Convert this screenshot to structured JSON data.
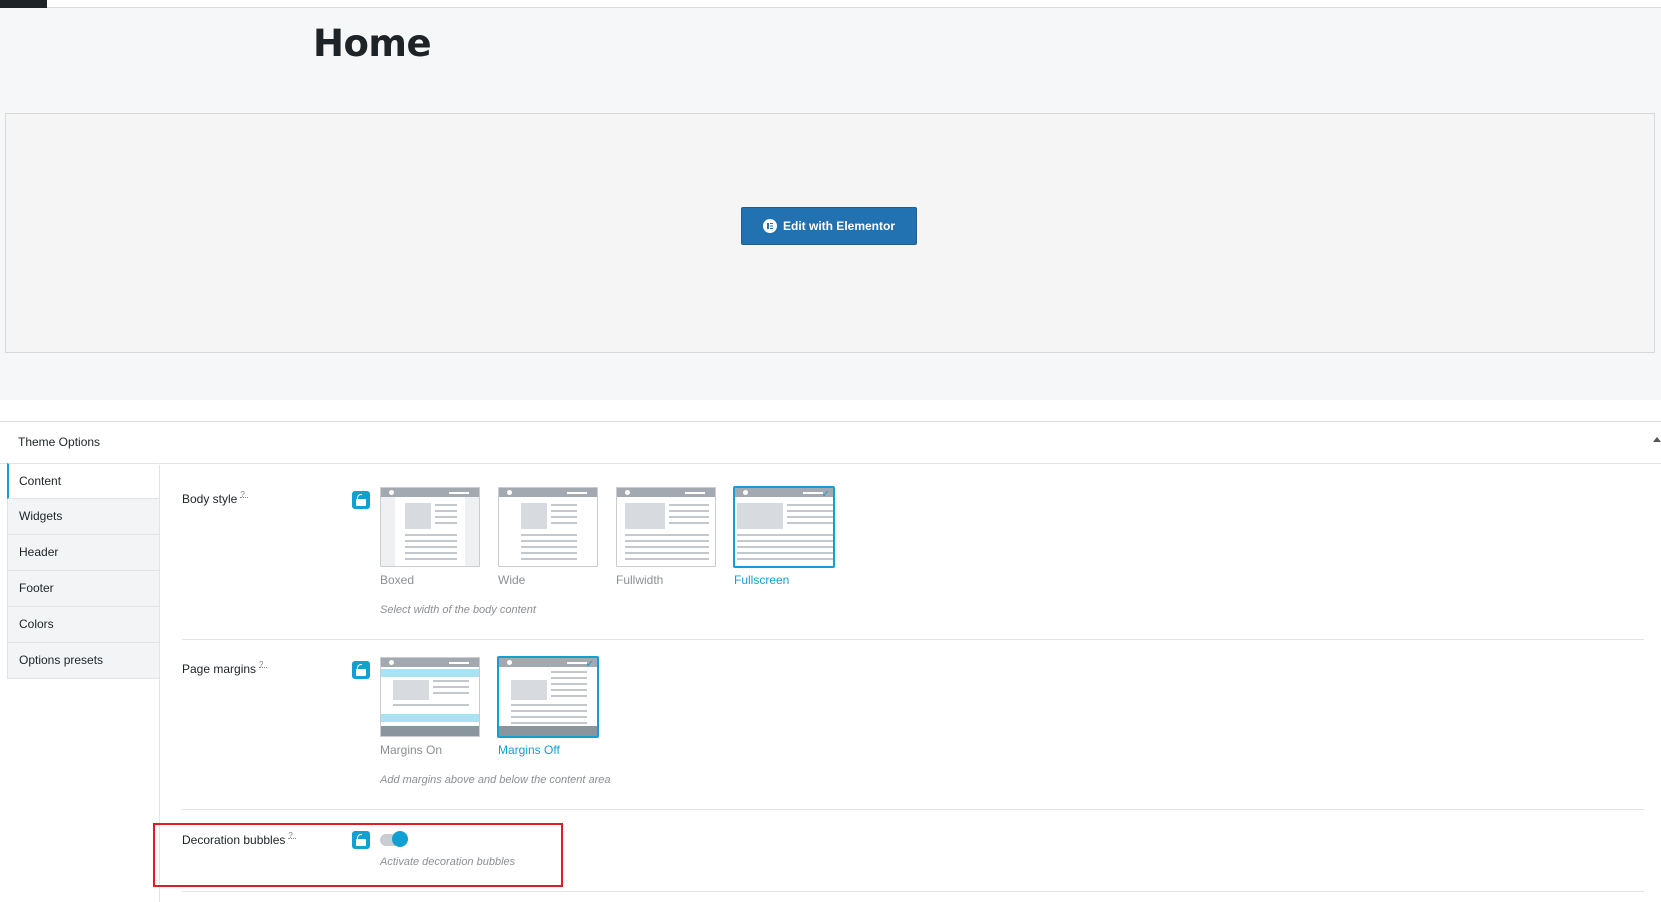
{
  "page": {
    "title": "Home"
  },
  "elementor": {
    "button_label": "Edit with Elementor"
  },
  "options": {
    "panel_title": "Theme Options",
    "tabs": [
      {
        "label": "Content",
        "active": true
      },
      {
        "label": "Widgets",
        "active": false
      },
      {
        "label": "Header",
        "active": false
      },
      {
        "label": "Footer",
        "active": false
      },
      {
        "label": "Colors",
        "active": false
      },
      {
        "label": "Options presets",
        "active": false
      }
    ],
    "body_style": {
      "label": "Body style",
      "choices": [
        "Boxed",
        "Wide",
        "Fullwidth",
        "Fullscreen"
      ],
      "selected": "Fullscreen",
      "description": "Select width of the body content"
    },
    "page_margins": {
      "label": "Page margins",
      "choices": [
        "Margins On",
        "Margins Off"
      ],
      "selected": "Margins Off",
      "description": "Add margins above and below the content area"
    },
    "decoration_bubbles": {
      "label": "Decoration bubbles",
      "enabled": true,
      "description": "Activate decoration bubbles"
    }
  },
  "colors": {
    "accent": "#11a0d2",
    "button": "#2271b1",
    "highlight": "#e31b23"
  },
  "icons": [
    "lock-icon",
    "elementor-icon",
    "check-icon",
    "collapse-caret-icon"
  ]
}
